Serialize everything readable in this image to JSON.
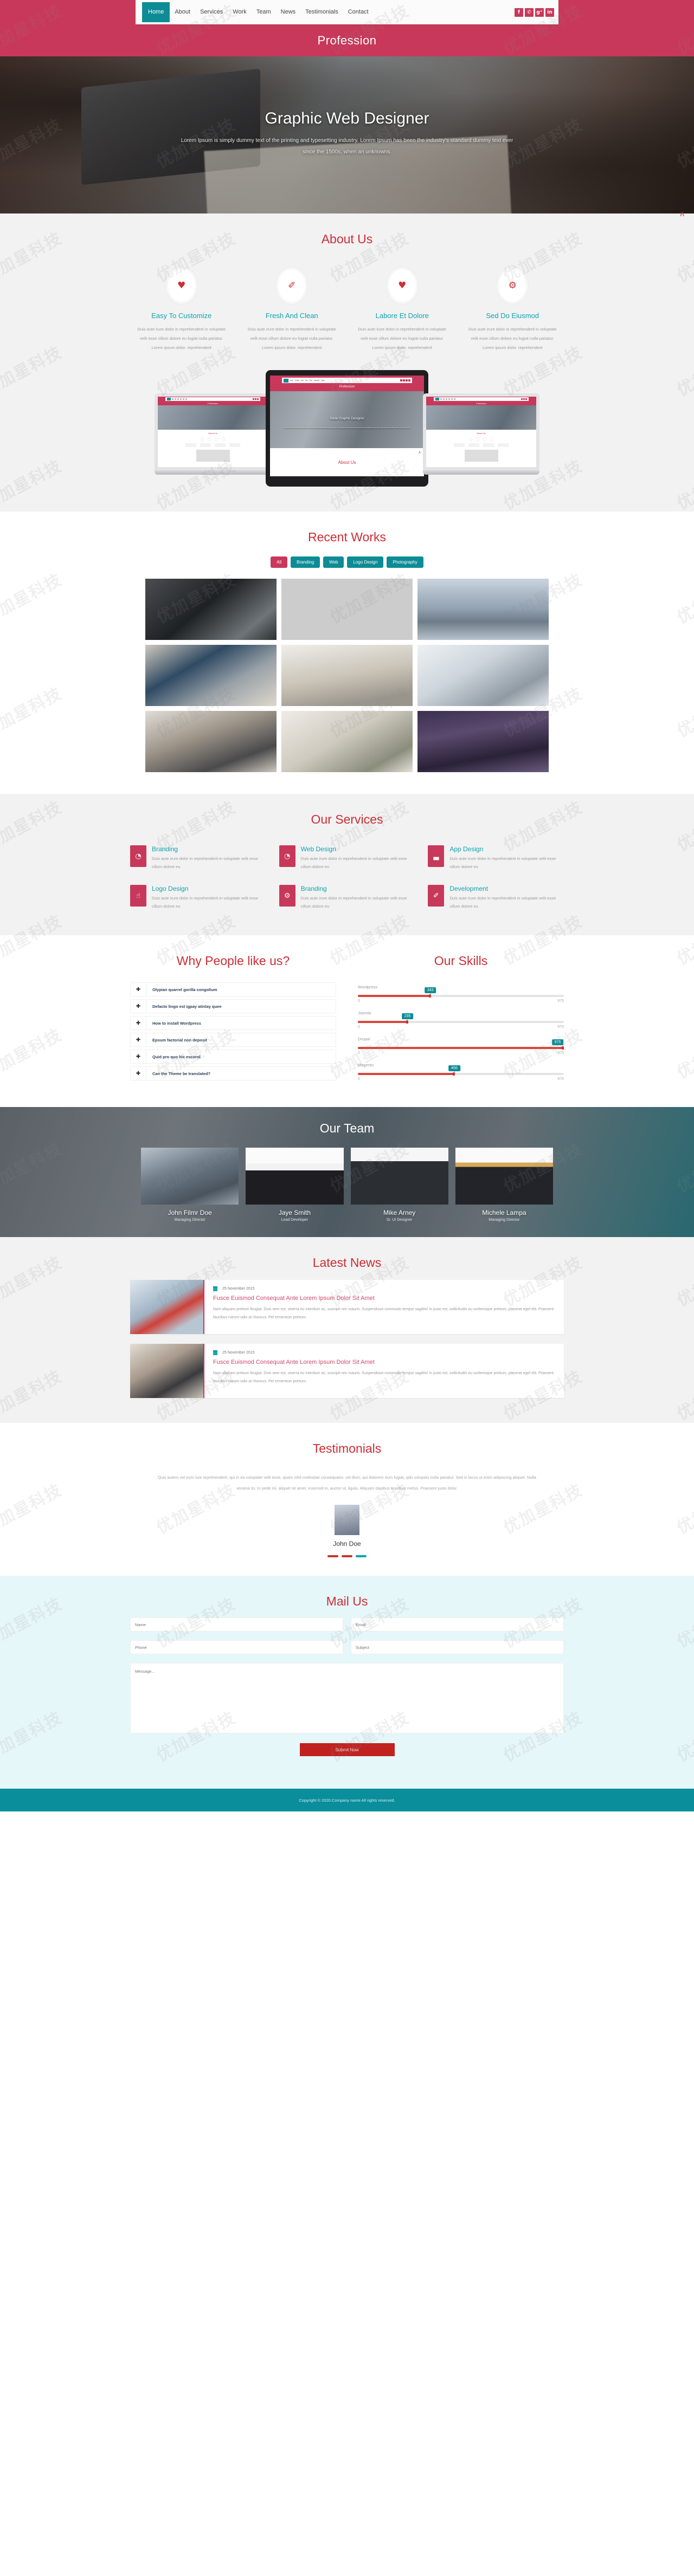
{
  "header": {
    "brand": "Profession",
    "nav": [
      {
        "label": "Home",
        "active": true
      },
      {
        "label": "About",
        "active": false
      },
      {
        "label": "Services",
        "active": false
      },
      {
        "label": "Work",
        "active": false
      },
      {
        "label": "Team",
        "active": false
      },
      {
        "label": "News",
        "active": false
      },
      {
        "label": "Testimonials",
        "active": false
      },
      {
        "label": "Contact",
        "active": false
      }
    ],
    "social": [
      {
        "name": "facebook-icon",
        "glyph": "f"
      },
      {
        "name": "twitter-icon",
        "glyph": "✆"
      },
      {
        "name": "google-plus-icon",
        "glyph": "g⁺"
      },
      {
        "name": "linkedin-icon",
        "glyph": "in"
      }
    ]
  },
  "hero": {
    "title": "Graphic Web Designer",
    "paragraph": "Lorem Ipsum is simply dummy text of the printing and typesetting industry. Lorem Ipsum has been the industry's standard dummy text ever since the 1500s, when an unknowns."
  },
  "about": {
    "title": "About Us",
    "scroll_top": "ʌ",
    "cards": [
      {
        "icon": "heart-solid-icon",
        "glyph": "♥",
        "title": "Easy To Customize",
        "text": "Duis aute irure dolor in reprehenderit in voluptate velit esse cillum dolore eu fugiat nulla pariatur. Lorem ipsum dolor. reprehenderit"
      },
      {
        "icon": "feather-icon",
        "glyph": "✐",
        "title": "Fresh And Clean",
        "text": "Duis aute irure dolor in reprehenderit in voluptate velit esse cillum dolore eu fugiat nulla pariatur. Lorem ipsum dolor. reprehenderit"
      },
      {
        "icon": "heart-icon",
        "glyph": "♥",
        "title": "Labore Et Dolore",
        "text": "Duis aute irure dolor in reprehenderit in voluptate velit esse cillum dolore eu fugiat nulla pariatur. Lorem ipsum dolor. reprehenderit"
      },
      {
        "icon": "gear-icon",
        "glyph": "⚙",
        "title": "Sed Do Eiusmod",
        "text": "Duis aute irure dolor in reprehenderit in voluptate velit esse cillum dolore eu fugiat nulla pariatur. Lorem ipsum dolor. reprehenderit"
      }
    ],
    "mockup": {
      "brand": "Profession",
      "hero_title": "Made Graphic Designer",
      "hero_text": "Lorem Ipsum is simply dummy text of the printing and typesetting industry. Lorem Ipsum has been the industry's standard dummy text ever since the 1500s, when an unknowns.",
      "section_label": "About Us"
    }
  },
  "works": {
    "title": "Recent Works",
    "filters": [
      {
        "label": "All",
        "active": true
      },
      {
        "label": "Branding",
        "active": false
      },
      {
        "label": "Web",
        "active": false
      },
      {
        "label": "Logo Design",
        "active": false
      },
      {
        "label": "Photography",
        "active": false
      }
    ],
    "items": [
      {
        "name": "car-dashboard-photo"
      },
      {
        "name": "tablet-desk-photo"
      },
      {
        "name": "city-skyline-photo"
      },
      {
        "name": "laptop-notebook-photo"
      },
      {
        "name": "office-desks-photo"
      },
      {
        "name": "woman-laptop-photo"
      },
      {
        "name": "man-working-photo"
      },
      {
        "name": "plant-desk-photo"
      },
      {
        "name": "night-city-photo"
      }
    ]
  },
  "services": {
    "title": "Our Services",
    "items": [
      {
        "icon": "globe-icon",
        "glyph": "◔",
        "title": "Branding",
        "text": "Duis aute irure dolor in reprehenderit in voluptate velit esse cillum dolore eu"
      },
      {
        "icon": "clock-icon",
        "glyph": "◔",
        "title": "Web Design",
        "text": "Duis aute irure dolor in reprehenderit in voluptate velit esse cillum dolore eu"
      },
      {
        "icon": "bar-chart-icon",
        "glyph": "▃",
        "title": "App Design",
        "text": "Duis aute irure dolor in reprehenderit in voluptate velit esse cillum dolore eu"
      },
      {
        "icon": "thumbs-up-icon",
        "glyph": "☝",
        "title": "Logo Design",
        "text": "Duis aute irure dolor in reprehenderit in voluptate velit esse cillum dolore eu"
      },
      {
        "icon": "gear-icon",
        "glyph": "⚙",
        "title": "Branding",
        "text": "Duis aute irure dolor in reprehenderit in voluptate velit esse cillum dolore eu"
      },
      {
        "icon": "leaf-icon",
        "glyph": "✐",
        "title": "Development",
        "text": "Duis aute irure dolor in reprehenderit in voluptate velit esse cillum dolore eu"
      }
    ]
  },
  "why": {
    "title": "Why People like us?",
    "items": [
      {
        "label": "Olypian quarrel gorilla congolium"
      },
      {
        "label": "Defacto lingo est igpay atinlay quee"
      },
      {
        "label": "How to install Wordpress"
      },
      {
        "label": "Epsum factorial non deposit"
      },
      {
        "label": "Quid pro quo hic escorol"
      },
      {
        "label": "Can the Theme be translated?"
      }
    ],
    "plus": "✚"
  },
  "skills": {
    "title": "Our Skills",
    "chart_data": {
      "type": "bar",
      "title": "Our Skills",
      "categories": [
        "Wordpress",
        "Joomla",
        "Drupal",
        "Magento"
      ],
      "values": [
        343,
        235,
        975,
        456
      ],
      "xlabel": "",
      "ylabel": "",
      "xlim": [
        0,
        975
      ],
      "min_label": "0",
      "max_label": "975",
      "grid": false,
      "legend": "none"
    }
  },
  "team": {
    "title": "Our Team",
    "members": [
      {
        "name": "John Filmr Doe",
        "role": "Managing Director",
        "photo": "man-suit-photo"
      },
      {
        "name": "Jaye Smith",
        "role": "Lead Developer",
        "photo": "woman-glasses-photo"
      },
      {
        "name": "Mike Arney",
        "role": "Sr. UI Designer",
        "photo": "man-dark-shirt-photo"
      },
      {
        "name": "Michele Lampa",
        "role": "Managing Director",
        "photo": "woman-blazer-photo"
      }
    ]
  },
  "news": {
    "title": "Latest News",
    "posts": [
      {
        "date": "25 November 2015",
        "title": "Fusce Euismod Consequat Ante Lorem Ipsum Dolor Sit Amet",
        "text": "Nam aliquam pretium feugiat. Duis sem est, viverra eu interdum ac, suscipit nec mauris. Suspendisse commodo tempor sagittis! In justo est, sollicitudin eu scelerisque pretium, placerat eget elit. Praesent faucibus rutrum odio at rhoncus. Pel ermentum pretium.",
        "thumb": "restaurant-interior-photo"
      },
      {
        "date": "25 November 2015",
        "title": "Fusce Euismod Consequat Ante Lorem Ipsum Dolor Sit Amet",
        "text": "Nam aliquam pretium feugiat. Duis sem est, viverra eu interdum ac, suscipit nec mauris. Suspendisse commodo tempor sagittis! In justo est, sollicitudin eu scelerisque pretium, placerat eget elit. Praesent faucibus rutrum odio at rhoncus. Pel ermentum pretium.",
        "thumb": "man-desk-photo"
      }
    ]
  },
  "testimonials": {
    "title": "Testimonials",
    "quote": "Quis autem vel eum iure reprehenderit, qui in ea voluptate velit esse, quam nihil molestiae consequatur, vel illum, qui dolorem eum fugiat, qdo voluptas nulla pariatur. Sed in lacus ut enim adipiscing aliquet. Nulla venena tis. In pede mi, aliquet sit amet, euismod in, auctor ut, ligula. Aliquam dapibus tincidunt metus. Praesent justo dolor.",
    "author": "John Doe",
    "avatar": "young-man-plaid-photo"
  },
  "mail": {
    "title": "Mail Us",
    "fields": {
      "name": {
        "placeholder": "Name",
        "value": ""
      },
      "email": {
        "placeholder": "Email",
        "value": ""
      },
      "phone": {
        "placeholder": "Phone",
        "value": ""
      },
      "subject": {
        "placeholder": "Subject",
        "value": ""
      },
      "message": {
        "placeholder": "Message...",
        "value": ""
      }
    },
    "submit_label": "Submit Now"
  },
  "footer": {
    "copyright": "Copyright © 2020.Company name All rights reserved."
  },
  "colors": {
    "brand_red": "#c8385a",
    "title_red": "#cc2e35",
    "teal": "#0e8c96",
    "accent_teal": "#0fa3ae",
    "bar_red": "#d9453c",
    "mail_bg": "#e6f7fa",
    "footer_bg": "#0a8e9b"
  }
}
